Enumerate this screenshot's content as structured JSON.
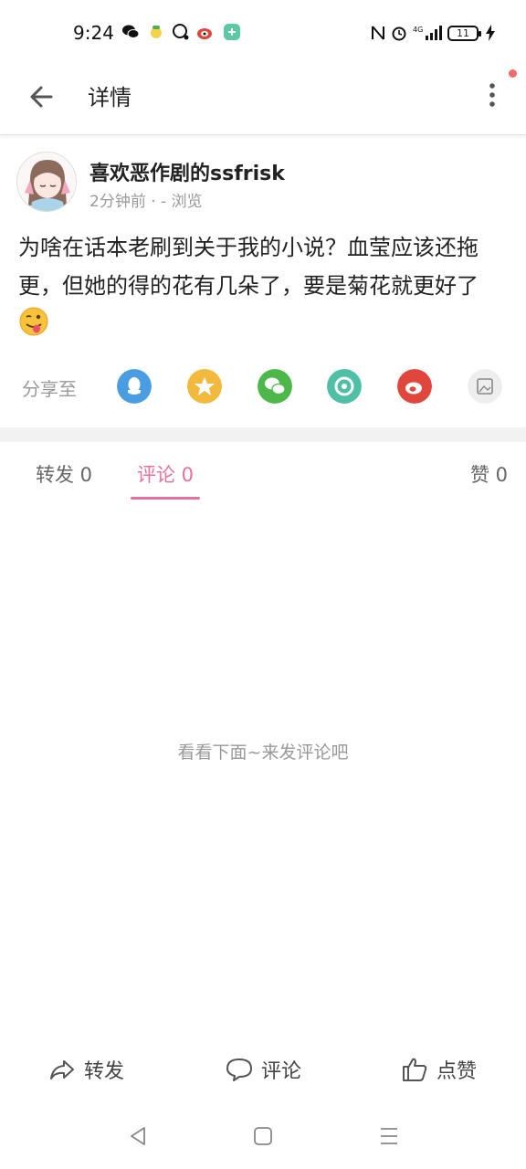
{
  "status_bar": {
    "time": "9:24",
    "left_icons": [
      "wechat-icon",
      "app-icon",
      "chat-bubble-icon",
      "weibo-icon",
      "app-green-icon"
    ],
    "right_icons": [
      "nfc-icon",
      "alarm-icon",
      "signal-4g-icon",
      "battery-icon",
      "charging-icon"
    ],
    "network": "4G",
    "battery": "11"
  },
  "top_bar": {
    "title": "详情",
    "back_icon": "arrow-left-icon",
    "more_icon": "more-vertical-icon",
    "notify_color": "#f06a6a"
  },
  "post": {
    "author": "喜欢恶作剧的ssfrisk",
    "meta": "2分钟前 · - 浏览",
    "content": "为啥在话本老刷到关于我的小说？血莹应该还拖更，但她的得的花有几朵了，要是菊花就更好了",
    "emoji": "winking-tongue-face"
  },
  "share": {
    "label": "分享至",
    "targets": [
      {
        "name": "qq-icon",
        "color": "#4a9de3"
      },
      {
        "name": "qzone-icon",
        "color": "#f2b93c"
      },
      {
        "name": "wechat-icon",
        "color": "#4cb84a"
      },
      {
        "name": "moments-icon",
        "color": "#4fbfa5"
      },
      {
        "name": "weibo-icon",
        "color": "#e0463c"
      },
      {
        "name": "save-image-icon",
        "color": "#eeeeee"
      }
    ]
  },
  "tabs": {
    "repost": "转发 0",
    "comment": "评论 0",
    "like": "赞 0",
    "active_color": "#e4729c"
  },
  "empty_hint": "看看下面~来发评论吧",
  "actions": {
    "repost": "转发",
    "comment": "评论",
    "like": "点赞"
  },
  "nav": [
    "back-triangle-icon",
    "home-square-icon",
    "menu-lines-icon"
  ]
}
